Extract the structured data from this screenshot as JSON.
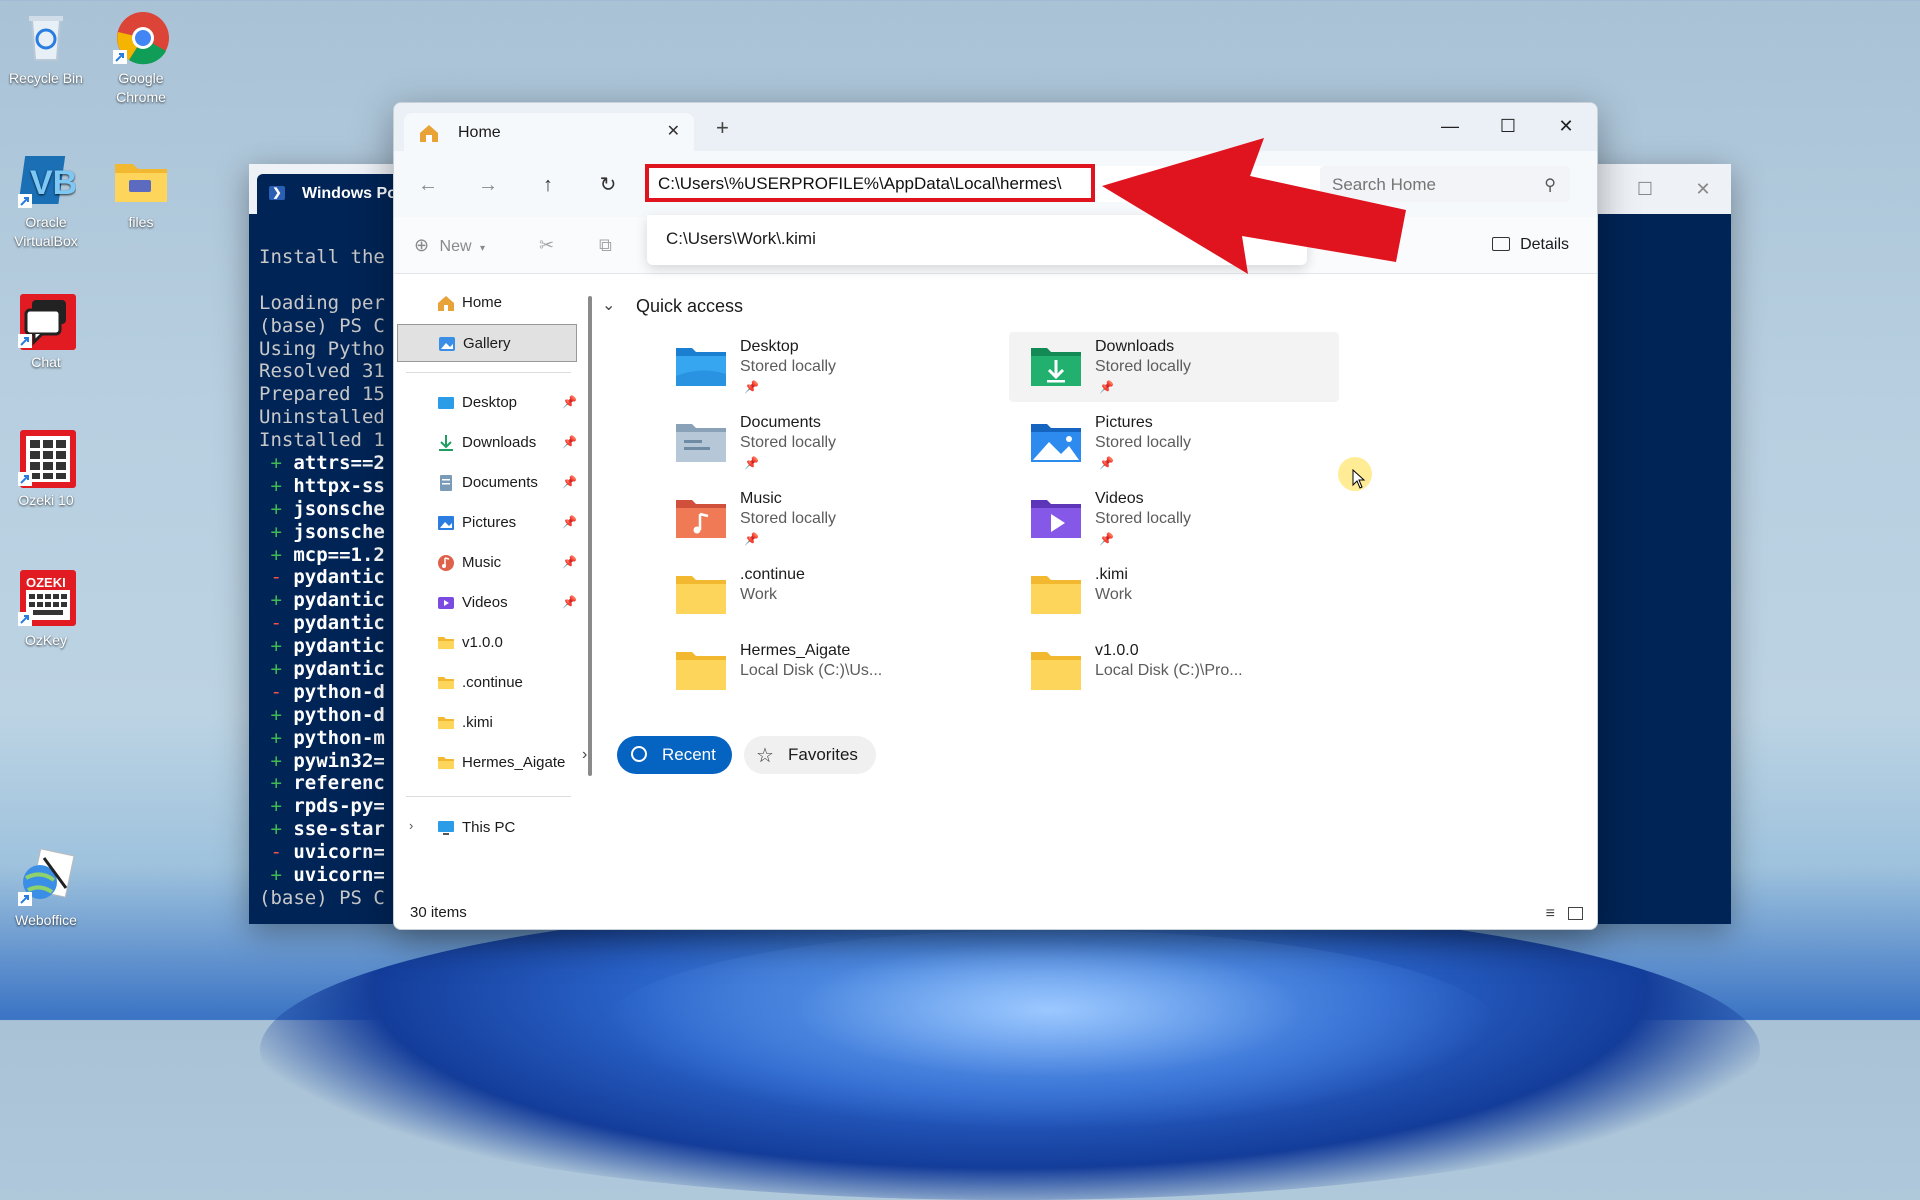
{
  "desktop": {
    "icons": [
      {
        "name": "recycle-bin",
        "label": "Recycle Bin"
      },
      {
        "name": "google-chrome",
        "label": "Google Chrome"
      },
      {
        "name": "oracle-virtualbox",
        "label": "Oracle VirtualBox"
      },
      {
        "name": "files",
        "label": "files"
      },
      {
        "name": "chat",
        "label": "Chat"
      },
      {
        "name": "ozeki-10",
        "label": "Ozeki 10"
      },
      {
        "name": "ozkey",
        "label": "OzKey"
      },
      {
        "name": "weboffice",
        "label": "Weboffice"
      }
    ],
    "ozkey_badge": "OZEKI"
  },
  "powershell": {
    "tab_title": "Windows Po",
    "lines": [
      {
        "prefix": "",
        "text": "Install the"
      },
      {
        "prefix": "",
        "text": ""
      },
      {
        "prefix": "",
        "text": "Loading per"
      },
      {
        "prefix": "",
        "text": "(base) PS C"
      },
      {
        "prefix": "",
        "text": "Using Pytho"
      },
      {
        "prefix": "",
        "text": "Resolved 31"
      },
      {
        "prefix": "",
        "text": "Prepared 15"
      },
      {
        "prefix": "",
        "text": "Uninstalled"
      },
      {
        "prefix": "",
        "text": "Installed 1"
      },
      {
        "prefix": "+",
        "text": "attrs==2"
      },
      {
        "prefix": "+",
        "text": "httpx-ss"
      },
      {
        "prefix": "+",
        "text": "jsonsche"
      },
      {
        "prefix": "+",
        "text": "jsonsche"
      },
      {
        "prefix": "+",
        "text": "mcp==1.2"
      },
      {
        "prefix": "-",
        "text": "pydantic"
      },
      {
        "prefix": "+",
        "text": "pydantic"
      },
      {
        "prefix": "-",
        "text": "pydantic"
      },
      {
        "prefix": "+",
        "text": "pydantic"
      },
      {
        "prefix": "+",
        "text": "pydantic"
      },
      {
        "prefix": "-",
        "text": "python-d"
      },
      {
        "prefix": "+",
        "text": "python-d"
      },
      {
        "prefix": "+",
        "text": "python-m"
      },
      {
        "prefix": "+",
        "text": "pywin32="
      },
      {
        "prefix": "+",
        "text": "referenc"
      },
      {
        "prefix": "+",
        "text": "rpds-py="
      },
      {
        "prefix": "+",
        "text": "sse-star"
      },
      {
        "prefix": "-",
        "text": "uvicorn="
      },
      {
        "prefix": "+",
        "text": "uvicorn="
      },
      {
        "prefix": "",
        "text": "(base) PS C"
      }
    ]
  },
  "explorer": {
    "tab_label": "Home",
    "tab_close": "✕",
    "new_tab": "+",
    "window_controls": {
      "minimize": "—",
      "maximize": "☐",
      "close": "✕"
    },
    "address_value": "C:\\Users\\%USERPROFILE%\\AppData\\Local\\hermes\\",
    "search_placeholder": "Search Home",
    "suggestion": "C:\\Users\\Work\\.kimi",
    "toolbar": {
      "new_label": "New",
      "details_label": "Details"
    },
    "sidebar": {
      "items": [
        {
          "label": "Home",
          "icon": "home-icon",
          "pinned": false
        },
        {
          "label": "Gallery",
          "icon": "gallery-icon",
          "pinned": false
        },
        {
          "label": "Desktop",
          "icon": "desktop-folder-icon",
          "pinned": true
        },
        {
          "label": "Downloads",
          "icon": "download-icon",
          "pinned": true
        },
        {
          "label": "Documents",
          "icon": "documents-icon",
          "pinned": true
        },
        {
          "label": "Pictures",
          "icon": "pictures-icon",
          "pinned": true
        },
        {
          "label": "Music",
          "icon": "music-icon",
          "pinned": true
        },
        {
          "label": "Videos",
          "icon": "videos-icon",
          "pinned": true
        },
        {
          "label": "v1.0.0",
          "icon": "folder-icon",
          "pinned": false
        },
        {
          "label": ".continue",
          "icon": "folder-icon",
          "pinned": false
        },
        {
          "label": ".kimi",
          "icon": "folder-icon",
          "pinned": false
        },
        {
          "label": "Hermes_Aigate",
          "icon": "folder-icon",
          "pinned": false
        },
        {
          "label": "This PC",
          "icon": "pc-icon",
          "pinned": false
        }
      ]
    },
    "quick_access": {
      "title": "Quick access",
      "folders": [
        {
          "name": "Desktop",
          "sub": "Stored locally",
          "pinned": true,
          "icon": "desktop-folder-icon"
        },
        {
          "name": "Downloads",
          "sub": "Stored locally",
          "pinned": true,
          "icon": "download-folder-icon"
        },
        {
          "name": "Documents",
          "sub": "Stored locally",
          "pinned": true,
          "icon": "documents-folder-icon"
        },
        {
          "name": "Pictures",
          "sub": "Stored locally",
          "pinned": true,
          "icon": "pictures-folder-icon"
        },
        {
          "name": "Music",
          "sub": "Stored locally",
          "pinned": true,
          "icon": "music-folder-icon"
        },
        {
          "name": "Videos",
          "sub": "Stored locally",
          "pinned": true,
          "icon": "videos-folder-icon"
        },
        {
          "name": ".continue",
          "sub": "Work",
          "pinned": false,
          "icon": "folder-icon"
        },
        {
          "name": ".kimi",
          "sub": "Work",
          "pinned": false,
          "icon": "folder-icon"
        },
        {
          "name": "Hermes_Aigate",
          "sub": "Local Disk (C:)\\Us...",
          "pinned": false,
          "icon": "folder-icon"
        },
        {
          "name": "v1.0.0",
          "sub": "Local Disk (C:)\\Pro...",
          "pinned": false,
          "icon": "folder-icon"
        }
      ]
    },
    "recent_label": "Recent",
    "favorites_label": "Favorites",
    "status": {
      "item_count": "30 items"
    }
  },
  "colors": {
    "annotation_red": "#e0141e",
    "accent_blue": "#0563c1",
    "powershell_bg": "#012456",
    "folder_yellow": "#f8cd4a"
  }
}
